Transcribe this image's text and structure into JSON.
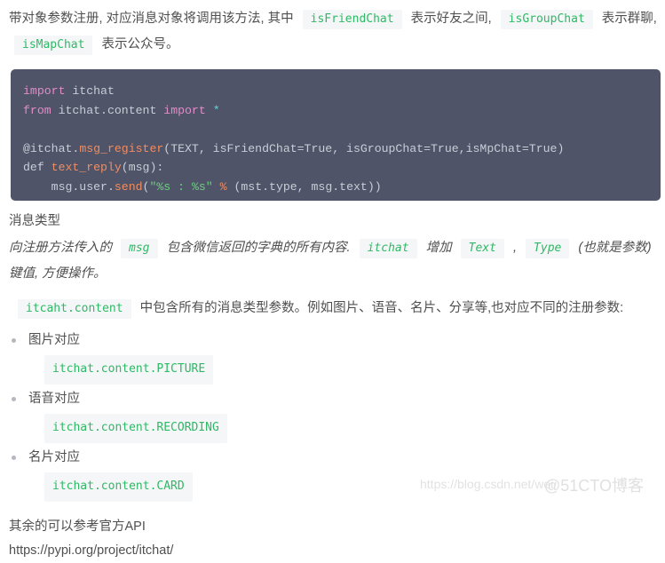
{
  "intro": {
    "seg1": "带对象参数注册, 对应消息对象将调用该方法, 其中",
    "code1": "isFriendChat",
    "seg2": "表示好友之间,",
    "code2": "isGroupChat",
    "seg3": "表示群聊,",
    "code3": "isMapChat",
    "seg4": "表示公众号。"
  },
  "code_block": {
    "language": "python",
    "lines": [
      {
        "tokens": [
          {
            "t": "import",
            "c": "k"
          },
          {
            "t": " itchat",
            "c": "pn"
          }
        ]
      },
      {
        "tokens": [
          {
            "t": "from",
            "c": "k"
          },
          {
            "t": " itchat.content ",
            "c": "pn"
          },
          {
            "t": "import",
            "c": "k"
          },
          {
            "t": " ",
            "c": "pn"
          },
          {
            "t": "*",
            "c": "op"
          }
        ]
      },
      {
        "tokens": []
      },
      {
        "tokens": [
          {
            "t": "@itchat.",
            "c": "pn"
          },
          {
            "t": "msg_register",
            "c": "fn"
          },
          {
            "t": "(TEXT, isFriendChat=True, isGroupChat=True,isMpChat=True)",
            "c": "pn"
          }
        ]
      },
      {
        "tokens": [
          {
            "t": "def ",
            "c": "pn"
          },
          {
            "t": "text_reply",
            "c": "fn"
          },
          {
            "t": "(msg):",
            "c": "pn"
          }
        ]
      },
      {
        "tokens": [
          {
            "t": "    msg.user.",
            "c": "pn"
          },
          {
            "t": "send",
            "c": "fn"
          },
          {
            "t": "(",
            "c": "pn"
          },
          {
            "t": "\"%s : %s\"",
            "c": "st"
          },
          {
            "t": " ",
            "c": "pn"
          },
          {
            "t": "%",
            "c": "pc"
          },
          {
            "t": " (mst.type, msg.text))",
            "c": "pn"
          }
        ]
      }
    ],
    "plain_text": "import itchat\nfrom itchat.content import *\n\n@itchat.msg_register(TEXT, isFriendChat=True, isGroupChat=True,isMpChat=True)\ndef text_reply(msg):\n    msg.user.send(\"%s : %s\" % (mst.type, msg.text))"
  },
  "section_heading": "消息类型",
  "italic_para": {
    "seg1": "向注册方法传入的",
    "code1": "msg",
    "seg2": "包含微信返回的字典的所有内容.",
    "code2": "itchat",
    "seg3": "增加",
    "code3": "Text",
    "seg4": ",",
    "code4": "Type",
    "seg5": "(也就是参数) 键值, 方便操作。"
  },
  "content_para": {
    "code1": "itcaht.content",
    "seg1": "中包含所有的消息类型参数。例如图片、语音、名片、分享等,也对应不同的注册参数:"
  },
  "bullets": [
    {
      "label": "图片对应",
      "code": "itchat.content.PICTURE"
    },
    {
      "label": "语音对应",
      "code": "itchat.content.RECORDING"
    },
    {
      "label": "名片对应",
      "code": "itchat.content.CARD"
    }
  ],
  "footer": {
    "line1": "其余的可以参考官方API",
    "link": "https://pypi.org/project/itchat/"
  },
  "watermarks": {
    "csdn": "https://blog.csdn.net/wei",
    "cto": "@51CTO博客"
  },
  "colors": {
    "code_bg": "#4f5468",
    "inline_code_text": "#2eb965",
    "inline_code_bg": "#f4f6f7",
    "body_text": "#4f4f4f",
    "keyword": "#e18cc8",
    "function": "#f08d63",
    "string": "#6fcf7f"
  }
}
